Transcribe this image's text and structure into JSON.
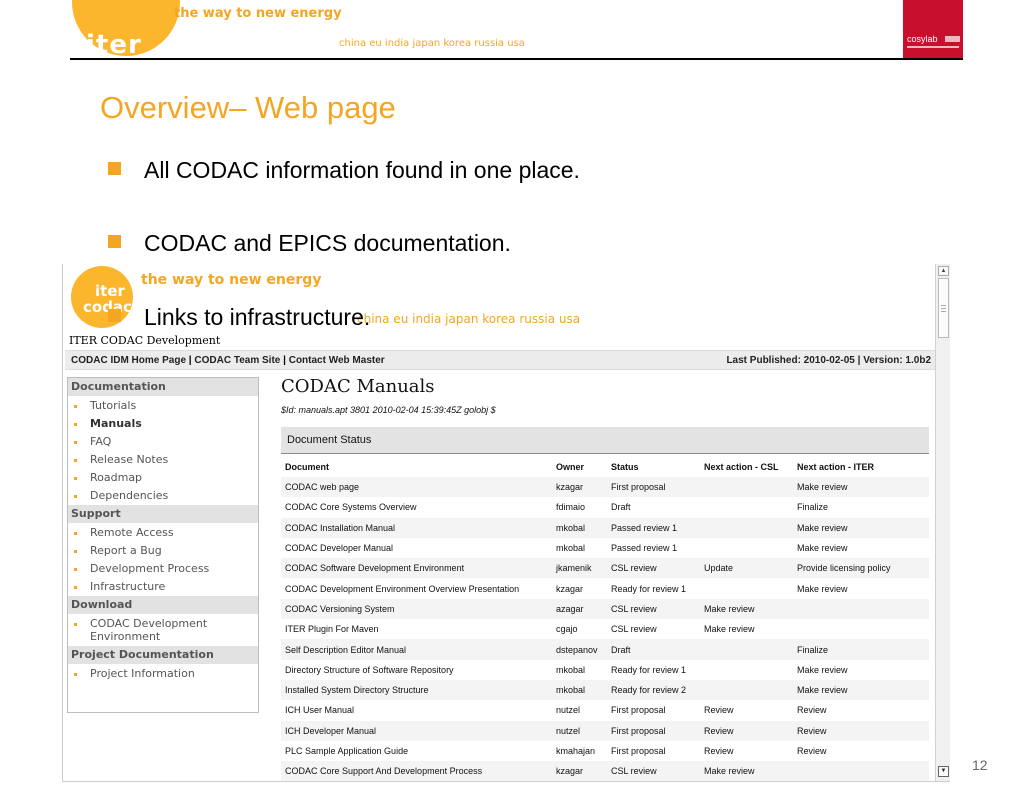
{
  "slide": {
    "logo_text": "iter",
    "tagline": "the way to new energy",
    "countries": "china eu india japan korea russia usa",
    "partner_logo": "cosylab",
    "title": "Overview– Web page",
    "bullets": [
      "All CODAC information found in one place.",
      "CODAC and EPICS documentation.",
      "Links to infrastructure."
    ],
    "page_number": "12",
    "accent_color": "#f4a623"
  },
  "site": {
    "logo_line1": "iter",
    "logo_line2": "codac",
    "tagline": "the way to new energy",
    "countries": "china eu india japan korea russia usa",
    "site_name": "ITER CODAC Development",
    "breadcrumb": {
      "links": [
        "CODAC IDM Home Page",
        "CODAC Team Site",
        "Contact Web Master"
      ],
      "separator": "|",
      "last_published": "Last Published: 2010-02-05  | Version: 1.0b2"
    },
    "sidebar": [
      {
        "header": "Documentation",
        "items": [
          "Tutorials",
          "Manuals",
          "FAQ",
          "Release Notes",
          "Roadmap",
          "Dependencies"
        ]
      },
      {
        "header": "Support",
        "items": [
          "Remote Access",
          "Report a Bug",
          "Development Process",
          "Infrastructure"
        ]
      },
      {
        "header": "Download",
        "items": [
          "CODAC Development Environment"
        ]
      },
      {
        "header": "Project Documentation",
        "items": [
          "Project Information"
        ]
      }
    ],
    "active_item": "Manuals",
    "content": {
      "title": "CODAC Manuals",
      "id_line": "$Id: manuals.apt 3801 2010-02-04 15:39:45Z golobj $",
      "section": "Document Status",
      "columns": [
        "Document",
        "Owner",
        "Status",
        "Next action - CSL",
        "Next action - ITER"
      ],
      "rows": [
        [
          "CODAC web page",
          "kzagar",
          "First proposal",
          "",
          "Make review"
        ],
        [
          "CODAC Core Systems Overview",
          "fdimaio",
          "Draft",
          "",
          "Finalize"
        ],
        [
          "CODAC Installation Manual",
          "mkobal",
          "Passed review 1",
          "",
          "Make review"
        ],
        [
          "CODAC Developer Manual",
          "mkobal",
          "Passed review 1",
          "",
          "Make review"
        ],
        [
          "CODAC Software Development Environment",
          "jkamenik",
          "CSL review",
          "Update",
          "Provide licensing policy"
        ],
        [
          "CODAC Development Environment Overview Presentation",
          "kzagar",
          "Ready for review 1",
          "",
          "Make review"
        ],
        [
          "CODAC Versioning System",
          "azagar",
          "CSL review",
          "Make review",
          ""
        ],
        [
          "ITER Plugin For Maven",
          "cgajo",
          "CSL review",
          "Make review",
          ""
        ],
        [
          "Self Description Editor Manual",
          "dstepanov",
          "Draft",
          "",
          "Finalize"
        ],
        [
          "Directory Structure of Software Repository",
          "mkobal",
          "Ready for review 1",
          "",
          "Make review"
        ],
        [
          "Installed System Directory Structure",
          "mkobal",
          "Ready for review 2",
          "",
          "Make review"
        ],
        [
          "ICH User Manual",
          "nutzel",
          "First proposal",
          "Review",
          "Review"
        ],
        [
          "ICH Developer Manual",
          "nutzel",
          "First proposal",
          "Review",
          "Review"
        ],
        [
          "PLC Sample Application Guide",
          "kmahajan",
          "First proposal",
          "Review",
          "Review"
        ],
        [
          "CODAC Core Support And Development Process",
          "kzagar",
          "CSL review",
          "Make review",
          ""
        ]
      ]
    }
  }
}
